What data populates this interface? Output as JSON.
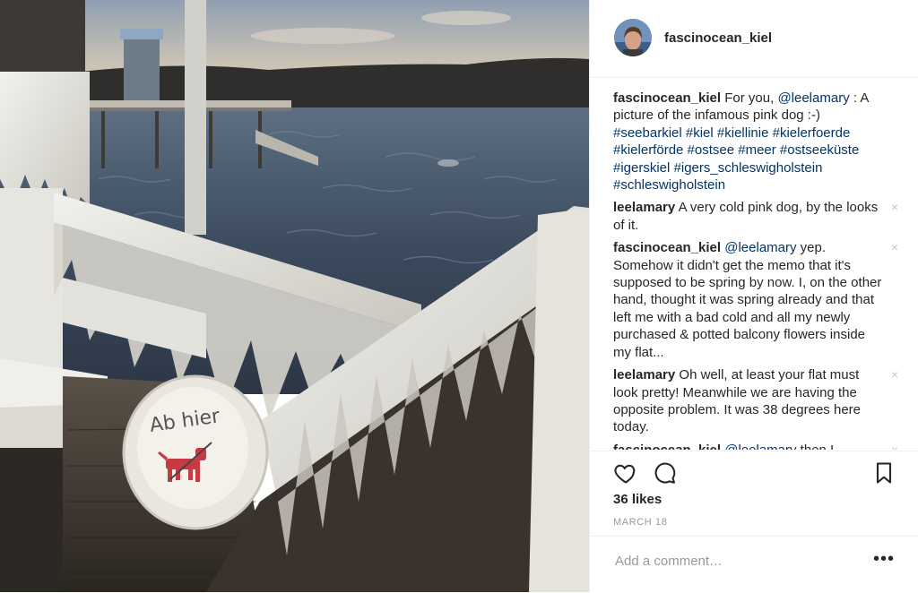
{
  "post": {
    "username": "fascinocean_kiel",
    "photo_sign_text": "Ab hier"
  },
  "comments": [
    {
      "user": "fascinocean_kiel",
      "parts": [
        {
          "t": "For you, "
        },
        {
          "t": "@leelamary",
          "m": true
        },
        {
          "t": " : A picture of the infamous pink dog :-) "
        },
        {
          "t": "#seebarkiel #kiel #kiellinie #kielerfoerde #kielerförde #ostsee #meer #ostseeküste #igerskiel #igers_schleswigholstein #schleswigholstein",
          "m": true
        }
      ],
      "removable": false
    },
    {
      "user": "leelamary",
      "parts": [
        {
          "t": "A very cold pink dog, by the looks of it."
        }
      ],
      "removable": true
    },
    {
      "user": "fascinocean_kiel",
      "parts": [
        {
          "t": "@leelamary",
          "m": true
        },
        {
          "t": " yep. Somehow it didn't get the memo that it's supposed to be spring by now. I, on the other hand, thought it was spring already and that left me with a bad cold and all my newly purchased & potted balcony flowers inside my flat..."
        }
      ],
      "removable": true
    },
    {
      "user": "leelamary",
      "parts": [
        {
          "t": "Oh well, at least your flat must look pretty! Meanwhile we are having the opposite problem. It was 38 degrees here today."
        }
      ],
      "removable": true
    },
    {
      "user": "fascinocean_kiel",
      "parts": [
        {
          "t": "@leelamary",
          "m": true
        },
        {
          "t": " then I"
        }
      ],
      "removable": true
    }
  ],
  "actions": {
    "like_icon": "heart-icon",
    "comment_icon": "comment-bubble-icon",
    "save_icon": "bookmark-icon",
    "remove_icon_glyph": "×"
  },
  "likes": "36 likes",
  "date": "MARCH 18",
  "add_comment": {
    "placeholder": "Add a comment…",
    "more_glyph": "•••"
  },
  "colors": {
    "text": "#262626",
    "mention": "#003569",
    "muted": "#999999",
    "border": "#efefef"
  }
}
